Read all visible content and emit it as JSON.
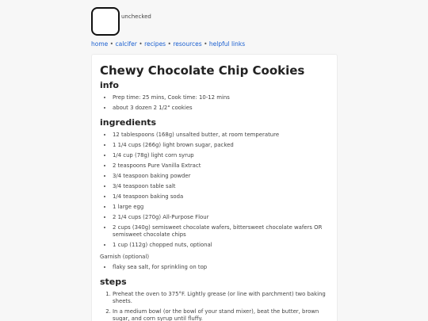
{
  "toggle": {
    "state_label": "unchecked"
  },
  "nav": {
    "links": [
      "home",
      "calcifer",
      "recipes",
      "resources",
      "helpful links"
    ],
    "separator": "•"
  },
  "recipe": {
    "title": "Chewy Chocolate Chip Cookies",
    "info_heading": "info",
    "info": [
      "Prep time: 25 mins, Cook time: 10-12 mins",
      "about 3 dozen 2 1/2\" cookies"
    ],
    "ingredients_heading": "ingredients",
    "ingredients": [
      "12 tablespoons (168g) unsalted butter, at room temperature",
      "1 1/4 cups (266g) light brown sugar, packed",
      "1/4 cup (78g) light corn syrup",
      "2 teaspoons Pure Vanilla Extract",
      "3/4 teaspoon baking powder",
      "3/4 teaspoon table salt",
      "1/4 teaspoon baking soda",
      "1 large egg",
      "2 1/4 cups (270g) All-Purpose Flour",
      "2 cups (340g) semisweet chocolate wafers, bittersweet chocolate wafers OR semisweet chocolate chips",
      "1 cup (112g) chopped nuts, optional"
    ],
    "garnish_heading": "Garnish (optional)",
    "garnish": [
      "flaky sea salt, for sprinkling on top"
    ],
    "steps_heading": "steps",
    "steps": [
      "Preheat the oven to 375°F. Lightly grease (or line with parchment) two baking sheets.",
      "In a medium bowl (or the bowl of your stand mixer), beat the butter, brown sugar, and corn syrup until fluffy."
    ]
  }
}
